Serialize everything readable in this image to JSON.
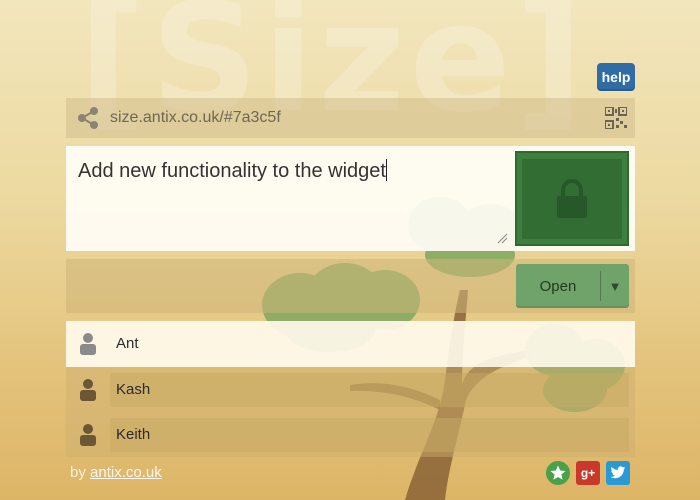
{
  "watermark": "[Size]",
  "help_label": "help",
  "url_bar": {
    "url": "size.antix.co.uk/#7a3c5f"
  },
  "editor": {
    "text": "Add new functionality to the widget"
  },
  "open_button": {
    "label": "Open",
    "arrow": "▼"
  },
  "users": [
    {
      "name": "Ant"
    },
    {
      "name": "Kash"
    },
    {
      "name": "Keith"
    }
  ],
  "footer": {
    "prefix": "by ",
    "link": "antix.co.uk"
  },
  "social": {
    "gplus": "g+"
  },
  "colors": {
    "accent_blue": "#2f6da4",
    "lock_green": "#3d7f3e",
    "open_green": "#6fa36a"
  },
  "icons": [
    "share-icon",
    "qr-code-icon",
    "lock-icon",
    "resize-grip-icon",
    "user-icon",
    "star-icon",
    "google-plus-icon",
    "twitter-icon"
  ]
}
